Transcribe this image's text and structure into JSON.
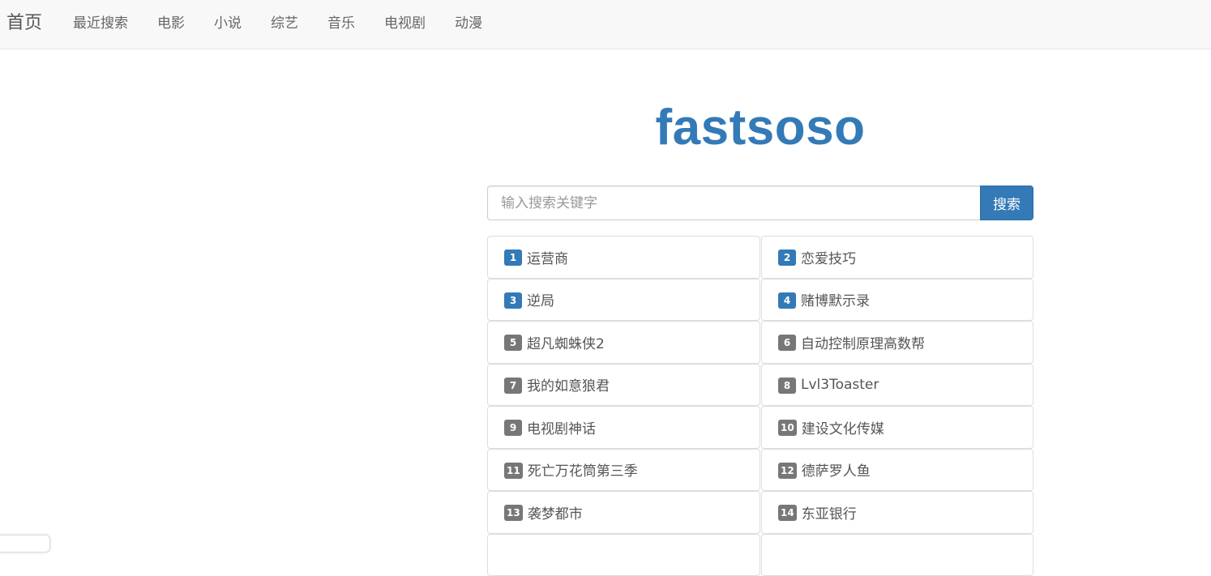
{
  "navbar": {
    "brand": "首页",
    "items": [
      "最近搜索",
      "电影",
      "小说",
      "综艺",
      "音乐",
      "电视剧",
      "动漫"
    ]
  },
  "logo": "fastsoso",
  "search": {
    "placeholder": "输入搜索关键字",
    "value": "",
    "button_label": "搜索"
  },
  "hot_list": [
    {
      "rank": "1",
      "label": "运营商",
      "highlight": true
    },
    {
      "rank": "2",
      "label": "恋爱技巧",
      "highlight": true
    },
    {
      "rank": "3",
      "label": "逆局",
      "highlight": true
    },
    {
      "rank": "4",
      "label": "赌博默示录",
      "highlight": true
    },
    {
      "rank": "5",
      "label": "超凡蜘蛛侠2",
      "highlight": false
    },
    {
      "rank": "6",
      "label": "自动控制原理高数帮",
      "highlight": false
    },
    {
      "rank": "7",
      "label": "我的如意狼君",
      "highlight": false
    },
    {
      "rank": "8",
      "label": "Lvl3Toaster",
      "highlight": false
    },
    {
      "rank": "9",
      "label": "电视剧神话",
      "highlight": false
    },
    {
      "rank": "10",
      "label": "建设文化传媒",
      "highlight": false
    },
    {
      "rank": "11",
      "label": "死亡万花筒第三季",
      "highlight": false
    },
    {
      "rank": "12",
      "label": "德萨罗人鱼",
      "highlight": false
    },
    {
      "rank": "13",
      "label": "袭梦都市",
      "highlight": false
    },
    {
      "rank": "14",
      "label": "东亚银行",
      "highlight": false
    },
    {
      "rank": "",
      "label": "",
      "highlight": false
    },
    {
      "rank": "",
      "label": "",
      "highlight": false
    }
  ],
  "colors": {
    "accent": "#337ab7",
    "badge_default": "#777777",
    "navbar_bg": "#f8f8f8"
  }
}
